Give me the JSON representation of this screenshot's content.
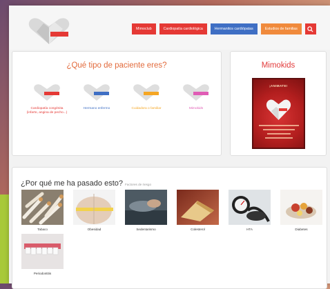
{
  "nav": {
    "buttons": [
      {
        "label": "Mimoclub",
        "color": "#e53935"
      },
      {
        "label": "Cardiopatía cardiológica",
        "color": "#e53935"
      },
      {
        "label": "Hermanitos cardiópatas",
        "color": "#3f6fc4"
      },
      {
        "label": "Estudios de familias",
        "color": "#f08a3c"
      }
    ],
    "search_icon": "search-icon",
    "search_color": "#e53935"
  },
  "patient_types": {
    "title": "¿Qué tipo de paciente eres?",
    "items": [
      {
        "label": "Cardiopatía congénita (infarto, angina de pecho...)",
        "color": "#e53935"
      },
      {
        "label": "Hermano enfermo",
        "color": "#3f6fc4"
      },
      {
        "label": "Cuidadora o familiar",
        "color": "#f5a623"
      },
      {
        "label": "Mimokids",
        "color": "#e05cb5"
      }
    ]
  },
  "mimokids": {
    "title": "Mimokids",
    "poster_heading": "¡ANIMATE!"
  },
  "causes": {
    "title": "¿Por qué me ha pasado esto?",
    "subtitle": "Factores de riesgo",
    "items": [
      {
        "label": "Tabaco"
      },
      {
        "label": "Obesidad"
      },
      {
        "label": "Sedentarismo"
      },
      {
        "label": "Colesterol"
      },
      {
        "label": "HTA"
      },
      {
        "label": "Diabetes"
      },
      {
        "label": "Periodontitis"
      }
    ]
  }
}
